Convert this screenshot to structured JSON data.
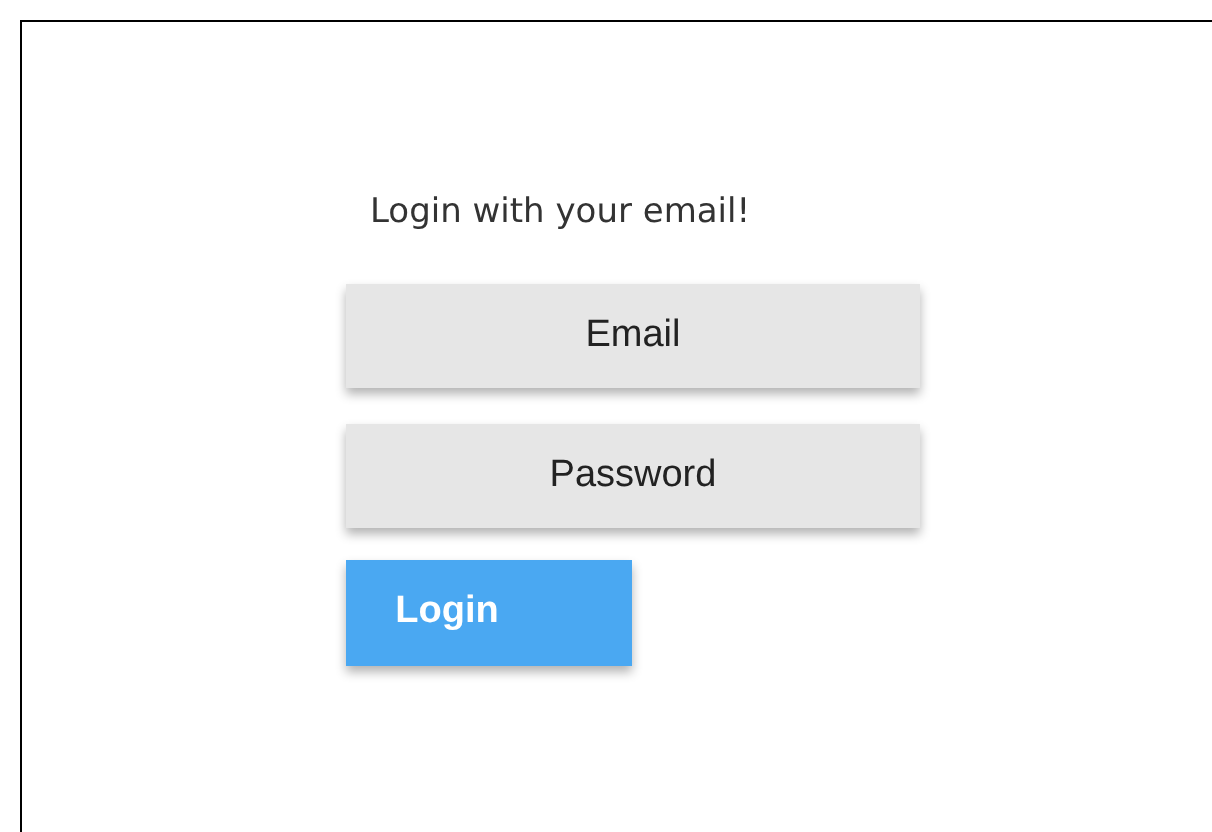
{
  "heading": "Login with your email!",
  "fields": [
    {
      "placeholder": "Email"
    },
    {
      "placeholder": "Password"
    }
  ],
  "button": "Login"
}
